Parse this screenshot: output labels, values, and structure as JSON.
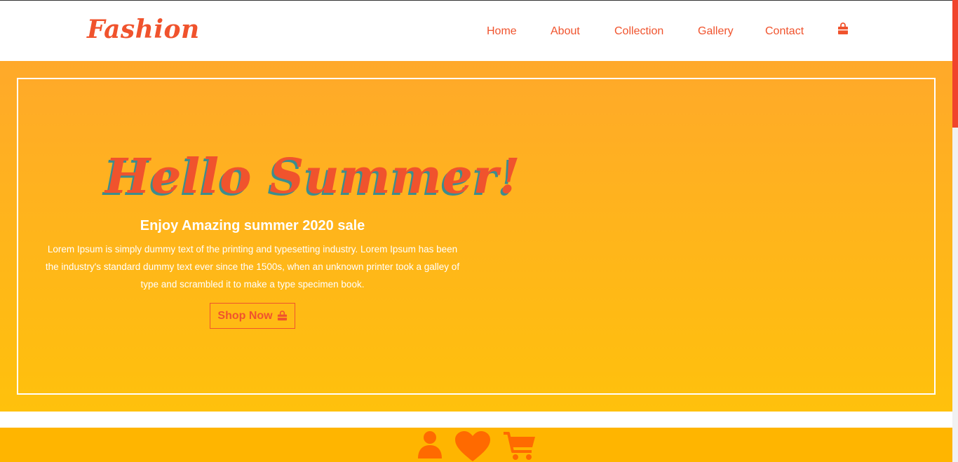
{
  "header": {
    "logo": "Fashion",
    "nav": {
      "home": "Home",
      "about": "About",
      "collection": "Collection",
      "gallery": "Gallery",
      "contact": "Contact"
    },
    "cart_icon": "shopping-bag-icon"
  },
  "hero": {
    "title": "Hello Summer!",
    "subtitle": "Enjoy Amazing summer 2020 sale",
    "text": "Lorem Ipsum is simply dummy text of the printing and typesetting industry. Lorem Ipsum has been the industry's standard dummy text ever since the 1500s, when an unknown printer took a galley of type and scrambled it to make a type specimen book.",
    "button_label": "Shop Now",
    "button_icon": "shopping-bag-icon"
  },
  "band": {
    "icons": [
      "user-icon",
      "heart-icon",
      "cart-icon"
    ]
  },
  "colors": {
    "brand": "#f0532d",
    "hero_gradient_top": "#ffa92a",
    "hero_gradient_bottom": "#ffc10c",
    "band": "#ffb500",
    "icon_orange": "#ff6a00",
    "title_shadow": "#3c8e8e"
  }
}
